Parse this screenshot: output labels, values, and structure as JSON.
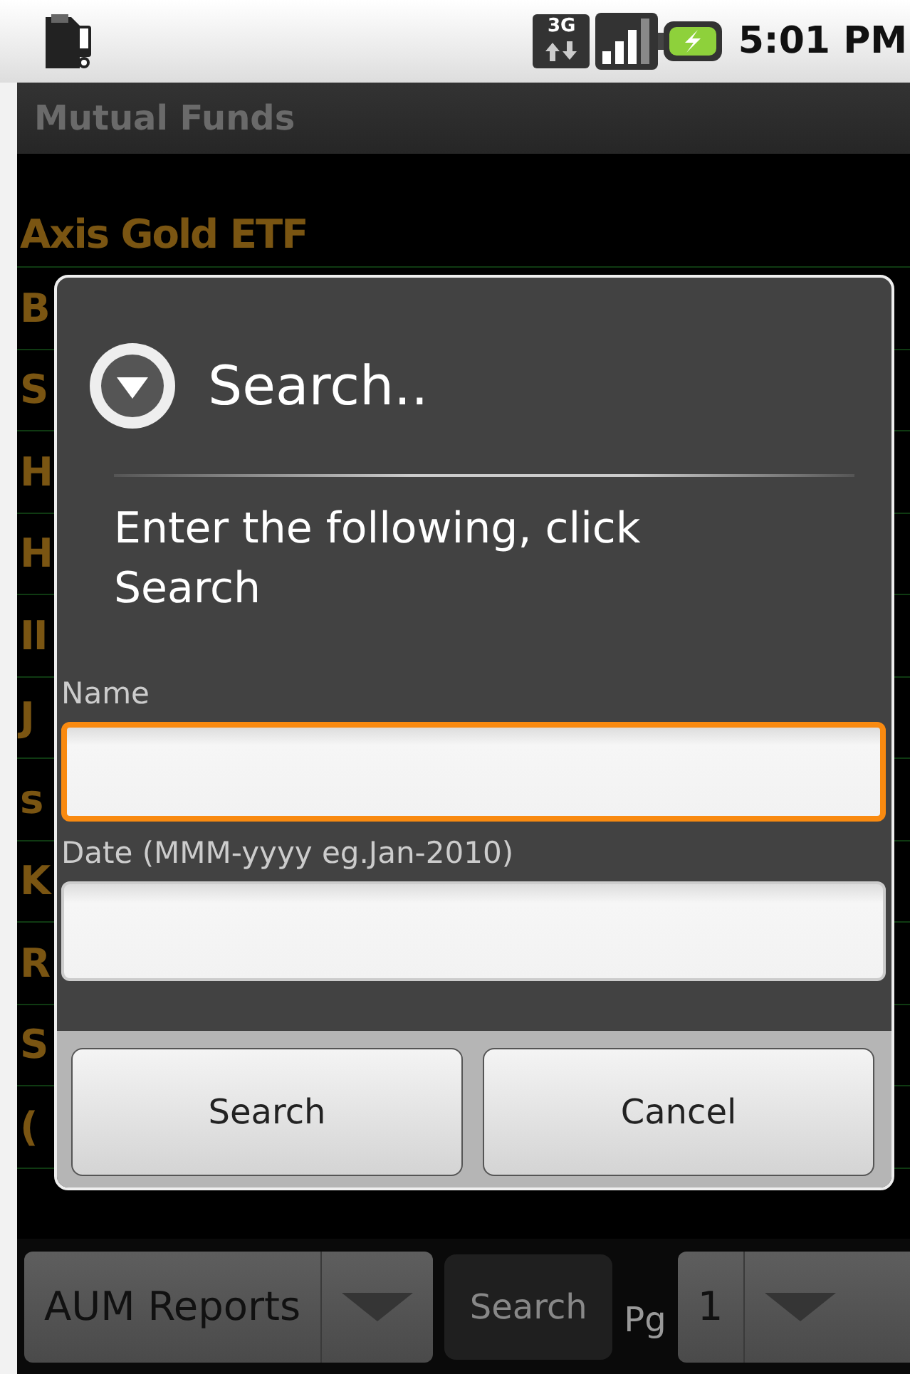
{
  "status_bar": {
    "network": "3G",
    "time": "5:01 PM"
  },
  "title_bar": {
    "title": "Mutual Funds"
  },
  "fund_list": {
    "rows": [
      "Axis Gold ETF",
      "B",
      "S",
      "H",
      "H",
      "II",
      "J",
      "s",
      "K",
      "R",
      "S",
      "("
    ]
  },
  "dialog": {
    "title": "Search..",
    "message": "Enter the following, click Search",
    "fields": [
      {
        "label": "Name",
        "focused": true
      },
      {
        "label": "Date (MMM-yyyy eg.Jan-2010)",
        "focused": false
      }
    ],
    "buttons": [
      "Search",
      "Cancel"
    ]
  },
  "bottom_bar": {
    "report_spinner": "AUM Reports",
    "search_button": "Search",
    "page_label": "Pg",
    "page_spinner": "1"
  }
}
